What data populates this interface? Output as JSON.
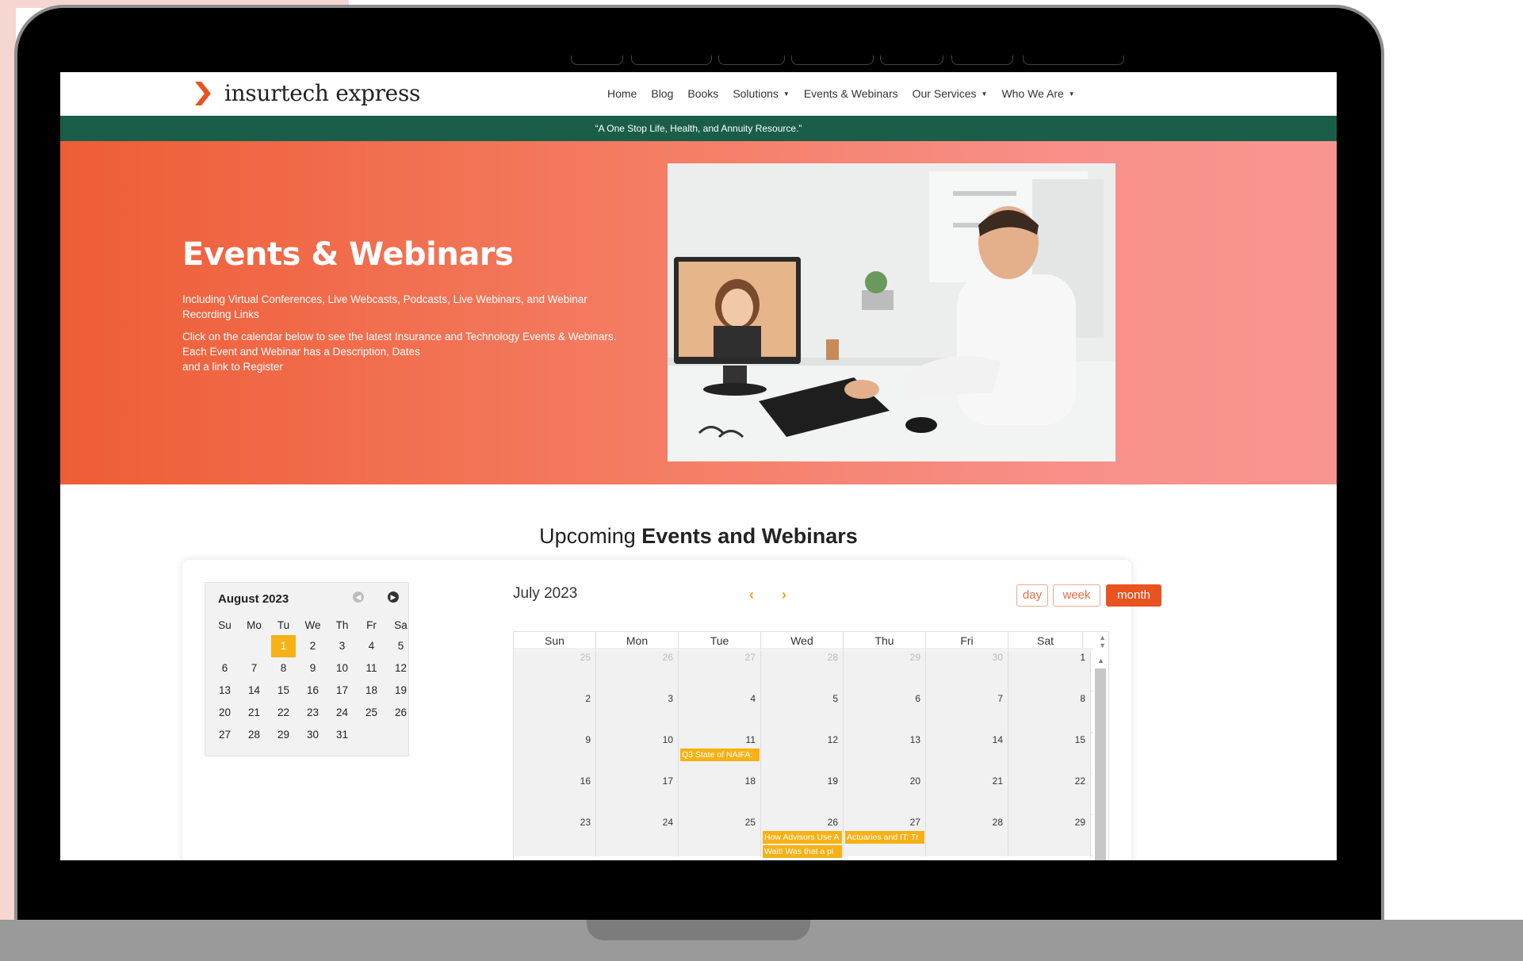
{
  "brand": {
    "name": "insurtech express",
    "accent": "#e9531f",
    "green": "#1a5e4a"
  },
  "nav": {
    "items": [
      {
        "label": "Home",
        "dropdown": false
      },
      {
        "label": "Blog",
        "dropdown": false
      },
      {
        "label": "Books",
        "dropdown": false
      },
      {
        "label": "Solutions",
        "dropdown": true
      },
      {
        "label": "Events & Webinars",
        "dropdown": false
      },
      {
        "label": "Our Services",
        "dropdown": true
      },
      {
        "label": "Who We Are",
        "dropdown": true
      }
    ]
  },
  "tagline": "“A One Stop Life, Health, and Annuity Resource.”",
  "hero": {
    "title": "Events & Webinars",
    "p1": "Including Virtual Conferences, Live Webcasts, Podcasts, Live Webinars, and Webinar Recording Links",
    "p2a": "Click on the calendar below to see the latest Insurance and Technology Events & Webinars. Each Event and Webinar has a Description, Dates",
    "p2b": "and a link to Register"
  },
  "upcoming": {
    "light": "Upcoming ",
    "bold": "Events and Webinars"
  },
  "mini_calendar": {
    "title": "August 2023",
    "weekdays": [
      "Su",
      "Mo",
      "Tu",
      "We",
      "Th",
      "Fr",
      "Sa"
    ],
    "weeks": [
      [
        "",
        "",
        "1",
        "2",
        "3",
        "4",
        "5"
      ],
      [
        "6",
        "7",
        "8",
        "9",
        "10",
        "11",
        "12"
      ],
      [
        "13",
        "14",
        "15",
        "16",
        "17",
        "18",
        "19"
      ],
      [
        "20",
        "21",
        "22",
        "23",
        "24",
        "25",
        "26"
      ],
      [
        "27",
        "28",
        "29",
        "30",
        "31",
        "",
        ""
      ]
    ],
    "today": "1"
  },
  "calendar": {
    "title": "July 2023",
    "views": {
      "day": "day",
      "week": "week",
      "month": "month"
    },
    "active_view": "month",
    "weekdays": [
      "Sun",
      "Mon",
      "Tue",
      "Wed",
      "Thu",
      "Fri",
      "Sat"
    ],
    "weeks": [
      [
        {
          "d": "25",
          "o": true
        },
        {
          "d": "26",
          "o": true
        },
        {
          "d": "27",
          "o": true
        },
        {
          "d": "28",
          "o": true
        },
        {
          "d": "29",
          "o": true
        },
        {
          "d": "30",
          "o": true
        },
        {
          "d": "1",
          "o": false
        }
      ],
      [
        {
          "d": "2"
        },
        {
          "d": "3"
        },
        {
          "d": "4"
        },
        {
          "d": "5"
        },
        {
          "d": "6"
        },
        {
          "d": "7"
        },
        {
          "d": "8"
        }
      ],
      [
        {
          "d": "9"
        },
        {
          "d": "10"
        },
        {
          "d": "11"
        },
        {
          "d": "12"
        },
        {
          "d": "13"
        },
        {
          "d": "14"
        },
        {
          "d": "15"
        }
      ],
      [
        {
          "d": "16"
        },
        {
          "d": "17"
        },
        {
          "d": "18"
        },
        {
          "d": "19"
        },
        {
          "d": "20"
        },
        {
          "d": "21"
        },
        {
          "d": "22"
        }
      ],
      [
        {
          "d": "23"
        },
        {
          "d": "24"
        },
        {
          "d": "25"
        },
        {
          "d": "26"
        },
        {
          "d": "27"
        },
        {
          "d": "28"
        },
        {
          "d": "29"
        }
      ]
    ],
    "events": [
      {
        "week": 2,
        "day": 2,
        "row": 0,
        "title": "Q3 State of NAIFA:"
      },
      {
        "week": 4,
        "day": 3,
        "row": 0,
        "title": "How Advisors Use A"
      },
      {
        "week": 4,
        "day": 4,
        "row": 0,
        "title": "Actuaries and IT: Tr"
      },
      {
        "week": 4,
        "day": 3,
        "row": 1,
        "title": "Wait! Was that a pi"
      }
    ]
  }
}
